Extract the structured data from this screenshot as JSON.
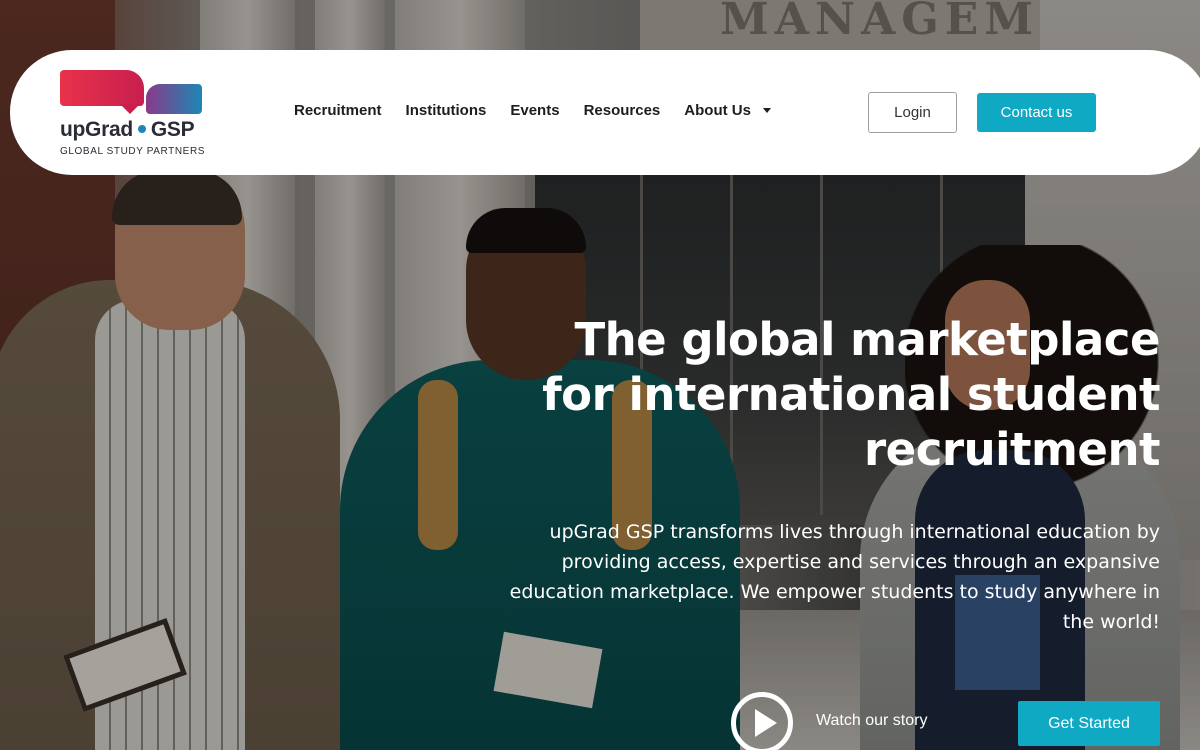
{
  "brand": {
    "name": "upGrad",
    "name_suffix": "GSP",
    "tagline": "GLOBAL STUDY PARTNERS"
  },
  "background_sign": "MANAGEM",
  "nav": {
    "items": [
      {
        "label": "Recruitment"
      },
      {
        "label": "Institutions"
      },
      {
        "label": "Events"
      },
      {
        "label": "Resources"
      },
      {
        "label": "About Us",
        "has_dropdown": true
      }
    ]
  },
  "header_actions": {
    "login_label": "Login",
    "contact_label": "Contact us"
  },
  "hero": {
    "headline_line1": "The global marketplace",
    "headline_line2": "for international student",
    "headline_line3": "recruitment",
    "subtext": "upGrad GSP transforms lives through international education by providing access, expertise and services through an expansive education marketplace. We empower students to study anywhere in the world!",
    "watch_label": "Watch our story",
    "cta_label": "Get Started"
  },
  "colors": {
    "accent": "#0fa9c4",
    "logo_red": "#e8324a",
    "logo_blue": "#1d87b4",
    "header_bg": "#ffffff",
    "hero_text": "#ffffff"
  },
  "icons": {
    "play": "play-icon",
    "dropdown": "chevron-down-icon"
  }
}
